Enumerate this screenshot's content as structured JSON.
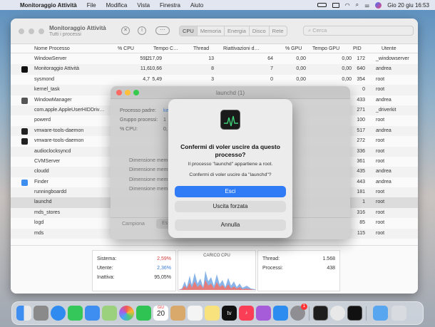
{
  "menubar": {
    "apple": "",
    "app": "Monitoraggio Attività",
    "items": [
      "File",
      "Modifica",
      "Vista",
      "Finestra",
      "Aiuto"
    ],
    "datetime": "Gio 20 giu  16:53"
  },
  "window": {
    "title": "Monitoraggio Attività",
    "subtitle": "Tutti i processi",
    "tabs": [
      "CPU",
      "Memoria",
      "Energia",
      "Disco",
      "Rete"
    ],
    "search_placeholder": "Cerca"
  },
  "columns": [
    "Nome Processo",
    "% CPU",
    "Tempo C…",
    "Thread",
    "Riattivazioni d…",
    "% GPU",
    "Tempo GPU",
    "PID",
    "Utente"
  ],
  "processes": [
    {
      "name": "WindowServer",
      "cpu": "59,2",
      "time": "1:17,09",
      "threads": "13",
      "wakeups": "64",
      "gpu": "0,00",
      "gputime": "0,00",
      "pid": "172",
      "user": "_windowserver",
      "icon": "none"
    },
    {
      "name": "Monitoraggio Attività",
      "cpu": "11,6",
      "time": "10,66",
      "threads": "8",
      "wakeups": "7",
      "gpu": "0,00",
      "gputime": "0,00",
      "pid": "640",
      "user": "andrea",
      "icon": "activity-monitor"
    },
    {
      "name": "sysmond",
      "cpu": "4,7",
      "time": "5,49",
      "threads": "3",
      "wakeups": "0",
      "gpu": "0,00",
      "gputime": "0,00",
      "pid": "354",
      "user": "root",
      "icon": "none"
    },
    {
      "name": "kernel_task",
      "cpu": "",
      "time": "",
      "threads": "",
      "wakeups": "",
      "gpu": "",
      "gputime": "",
      "pid": "0",
      "user": "root",
      "icon": "none"
    },
    {
      "name": "WindowManager",
      "cpu": "",
      "time": "",
      "threads": "",
      "wakeups": "",
      "gpu": "",
      "gputime": "",
      "pid": "433",
      "user": "andrea",
      "icon": "window"
    },
    {
      "name": "com.apple.AppleUserHIDDriv…",
      "cpu": "",
      "time": "",
      "threads": "",
      "wakeups": "",
      "gpu": "",
      "gputime": "",
      "pid": "271",
      "user": "_driverkit",
      "icon": "none"
    },
    {
      "name": "powerd",
      "cpu": "",
      "time": "",
      "threads": "",
      "wakeups": "",
      "gpu": "",
      "gputime": "",
      "pid": "100",
      "user": "root",
      "icon": "none"
    },
    {
      "name": "vmware-tools-daemon",
      "cpu": "",
      "time": "",
      "threads": "",
      "wakeups": "",
      "gpu": "",
      "gputime": "",
      "pid": "517",
      "user": "andrea",
      "icon": "terminal"
    },
    {
      "name": "vmware-tools-daemon",
      "cpu": "",
      "time": "",
      "threads": "",
      "wakeups": "",
      "gpu": "",
      "gputime": "",
      "pid": "272",
      "user": "root",
      "icon": "terminal"
    },
    {
      "name": "audioclocksyncd",
      "cpu": "",
      "time": "",
      "threads": "",
      "wakeups": "",
      "gpu": "",
      "gputime": "",
      "pid": "336",
      "user": "root",
      "icon": "none"
    },
    {
      "name": "CVMServer",
      "cpu": "",
      "time": "",
      "threads": "",
      "wakeups": "",
      "gpu": "",
      "gputime": "",
      "pid": "361",
      "user": "root",
      "icon": "none"
    },
    {
      "name": "cloudd",
      "cpu": "",
      "time": "",
      "threads": "",
      "wakeups": "",
      "gpu": "",
      "gputime": "",
      "pid": "435",
      "user": "andrea",
      "icon": "none"
    },
    {
      "name": "Finder",
      "cpu": "",
      "time": "",
      "threads": "",
      "wakeups": "",
      "gpu": "",
      "gputime": "",
      "pid": "443",
      "user": "andrea",
      "icon": "finder"
    },
    {
      "name": "runningboardd",
      "cpu": "",
      "time": "",
      "threads": "",
      "wakeups": "",
      "gpu": "",
      "gputime": "",
      "pid": "181",
      "user": "root",
      "icon": "none"
    },
    {
      "name": "launchd",
      "cpu": "",
      "time": "",
      "threads": "",
      "wakeups": "",
      "gpu": "",
      "gputime": "",
      "pid": "1",
      "user": "root",
      "icon": "none"
    },
    {
      "name": "mds_stores",
      "cpu": "",
      "time": "",
      "threads": "",
      "wakeups": "",
      "gpu": "",
      "gputime": "",
      "pid": "316",
      "user": "root",
      "icon": "none"
    },
    {
      "name": "logd",
      "cpu": "",
      "time": "",
      "threads": "",
      "wakeups": "",
      "gpu": "",
      "gputime": "",
      "pid": "85",
      "user": "root",
      "icon": "none"
    },
    {
      "name": "mds",
      "cpu": "",
      "time": "",
      "threads": "",
      "wakeups": "",
      "gpu": "",
      "gputime": "",
      "pid": "115",
      "user": "root",
      "icon": "none"
    }
  ],
  "cpu_summary": {
    "sistema_label": "Sistema:",
    "sistema": "2,59%",
    "utente_label": "Utente:",
    "utente": "2,36%",
    "inattiva_label": "Inattiva:",
    "inattiva": "95,05%",
    "chart_title": "CARICO CPU",
    "thread_label": "Thread:",
    "thread": "1.568",
    "processi_label": "Processi:",
    "processi": "438"
  },
  "background_dialog": {
    "title": "launchd (1)",
    "labels": [
      "Processo padre:",
      "Gruppo processi:",
      "% CPU:"
    ],
    "values": [
      "ke",
      "1",
      "0,"
    ],
    "mem_label": "Dimensione mem…",
    "buttons": [
      "Campiona",
      "Es"
    ]
  },
  "confirm": {
    "title": "Confermi di voler uscire da questo processo?",
    "message1": "Il processo \"launchd\" appartiene a root.",
    "message2": "Confermi di voler uscire da \"launchd\"?",
    "btn_quit": "Esci",
    "btn_force": "Uscita forzata",
    "btn_cancel": "Annulla"
  },
  "dock": {
    "calendar_month": "GIU",
    "calendar_day": "20",
    "badge": "1"
  }
}
